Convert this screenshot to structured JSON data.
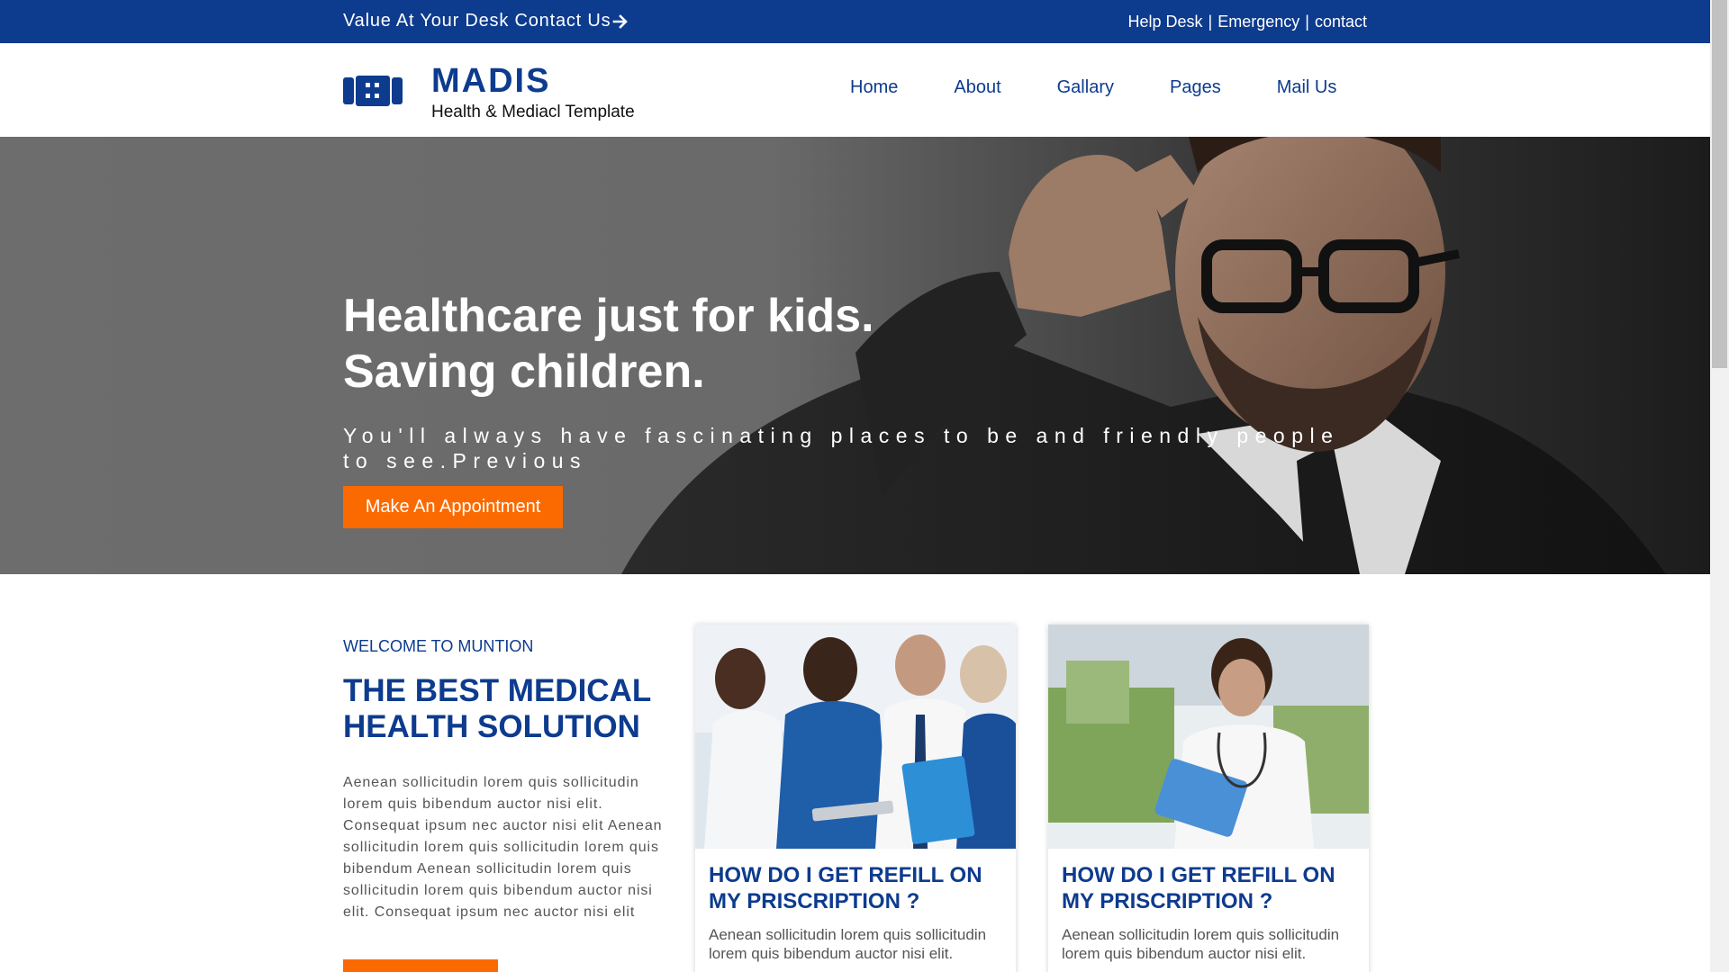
{
  "topbar": {
    "tagline": "Value At Your Desk Contact Us",
    "links": [
      "Help Desk",
      "Emergency",
      "contact"
    ],
    "separator": "|"
  },
  "brand": {
    "name": "MADIS",
    "tagline": "Health & Mediacl Template"
  },
  "nav": [
    "Home",
    "About",
    "Gallary",
    "Pages",
    "Mail Us"
  ],
  "hero": {
    "title_line1": "Healthcare just for kids.",
    "title_line2": "Saving children.",
    "subtitle": "You'll always have fascinating places to be and friendly people to see.Previous",
    "cta": "Make An Appointment"
  },
  "welcome": {
    "kicker": "WELCOME TO MUNTION",
    "title": "THE BEST MEDICAL HEALTH SOLUTION",
    "body": "Aenean sollicitudin lorem quis sollicitudin lorem quis bibendum auctor nisi elit. Consequat ipsum nec auctor nisi elit Aenean sollicitudin lorem quis sollicitudin lorem quis bibendum Aenean sollicitudin lorem quis sollicitudin lorem quis bibendum auctor nisi elit. Consequat ipsum nec auctor nisi elit"
  },
  "cards": [
    {
      "title": "HOW DO I GET REFILL ON MY PRISCRIPTION ?",
      "text": "Aenean sollicitudin lorem quis sollicitudin lorem quis bibendum auctor nisi elit."
    },
    {
      "title": "HOW DO I GET REFILL ON MY PRISCRIPTION ?",
      "text": "Aenean sollicitudin lorem quis sollicitudin lorem quis bibendum auctor nisi elit."
    }
  ],
  "colors": {
    "primary": "#0d3b8e",
    "accent": "#fb6a00",
    "text_muted": "#555555"
  },
  "icons": [
    "arrow-right-icon",
    "hospital-logo-icon"
  ]
}
